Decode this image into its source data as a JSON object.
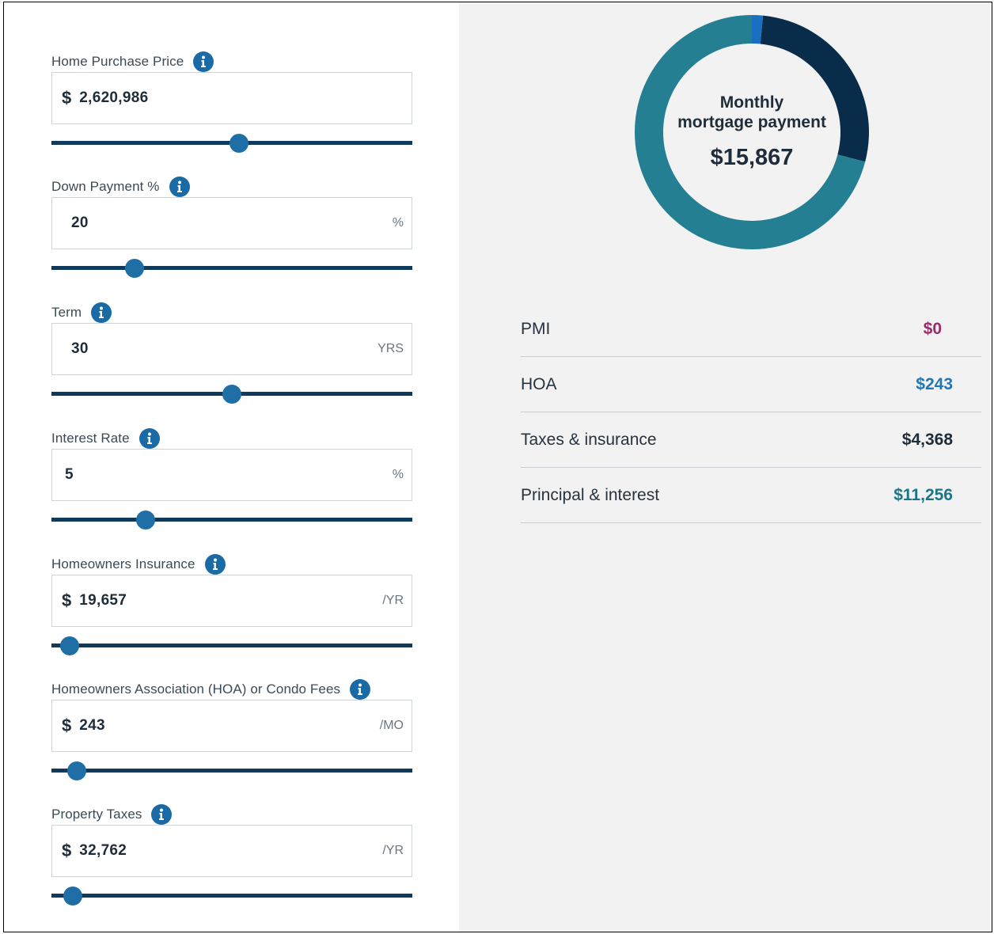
{
  "colors": {
    "slider_track": "#0f3a5c",
    "slider_thumb": "#1f6fa6",
    "info_icon": "#1a6aa6",
    "donut_principal": "#247f93",
    "donut_taxes": "#082c4a",
    "donut_hoa": "#1a6fc0",
    "pmi": "#9b2c6b",
    "hoa": "#1f78b4",
    "taxes": "#1f2d3a",
    "principal": "#1a7586"
  },
  "fields": [
    {
      "label": "Home Purchase Price",
      "prefix": "$",
      "value": "2,620,986",
      "unit": "",
      "slider_position": 0.52,
      "icon": "info-icon"
    },
    {
      "label": "Down Payment %",
      "prefix": "",
      "value": "20",
      "unit": "%",
      "slider_position": 0.23,
      "icon": "info-icon"
    },
    {
      "label": "Term",
      "prefix": "",
      "value": "30",
      "unit": "YRS",
      "slider_position": 0.5,
      "icon": "info-icon"
    },
    {
      "label": "Interest Rate",
      "prefix": "",
      "value": "5",
      "unit": "%",
      "slider_position": 0.26,
      "icon": "info-icon"
    },
    {
      "label": "Homeowners Insurance",
      "prefix": "$",
      "value": "19,657",
      "unit": "/YR",
      "slider_position": 0.05,
      "icon": "info-icon"
    },
    {
      "label": "Homeowners Association (HOA) or Condo Fees",
      "prefix": "$",
      "value": "243",
      "unit": "/MO",
      "slider_position": 0.07,
      "icon": "info-icon"
    },
    {
      "label": "Property Taxes",
      "prefix": "$",
      "value": "32,762",
      "unit": "/YR",
      "slider_position": 0.06,
      "icon": "info-icon"
    }
  ],
  "summary": {
    "title_line1": "Monthly",
    "title_line2": "mortgage payment",
    "amount": "$15,867"
  },
  "breakdown": [
    {
      "label": "PMI",
      "value": "$0",
      "amount": 0,
      "color": "#9b2c6b"
    },
    {
      "label": "HOA",
      "value": "$243",
      "amount": 243,
      "color": "#1f78b4"
    },
    {
      "label": "Taxes & insurance",
      "value": "$4,368",
      "amount": 4368,
      "color": "#1f2d3a"
    },
    {
      "label": "Principal & interest",
      "value": "$11,256",
      "amount": 11256,
      "color": "#1a7586"
    }
  ],
  "chart_data": {
    "type": "pie",
    "categories": [
      "HOA",
      "Taxes & insurance",
      "Principal & interest"
    ],
    "values": [
      243,
      4368,
      11256
    ],
    "colors": [
      "#1a6fc0",
      "#082c4a",
      "#247f93"
    ]
  }
}
